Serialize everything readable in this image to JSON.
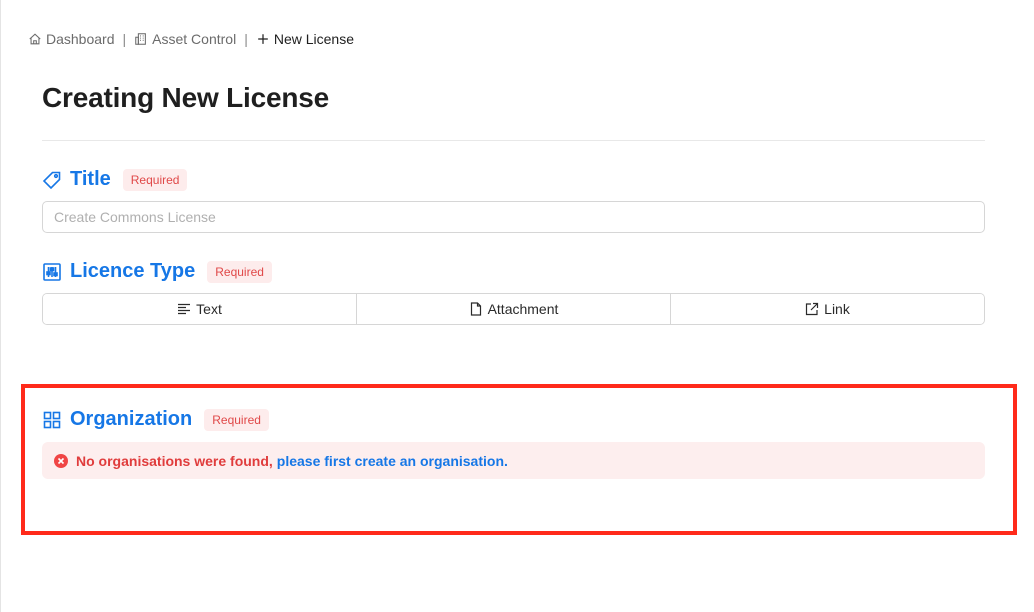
{
  "breadcrumb": {
    "items": [
      {
        "label": "Dashboard",
        "icon": "home-icon"
      },
      {
        "label": "Asset Control",
        "icon": "building-icon"
      },
      {
        "label": "New License",
        "icon": "plus-icon"
      }
    ],
    "separator": "|"
  },
  "page": {
    "title": "Creating New License"
  },
  "sections": {
    "title": {
      "label": "Title",
      "badge": "Required",
      "icon": "tag-icon",
      "placeholder": "Create Commons License",
      "value": ""
    },
    "licence_type": {
      "label": "Licence Type",
      "badge": "Required",
      "icon": "sliders-icon",
      "options": [
        {
          "label": "Text",
          "icon": "text-lines-icon"
        },
        {
          "label": "Attachment",
          "icon": "file-icon"
        },
        {
          "label": "Link",
          "icon": "external-link-icon"
        }
      ]
    },
    "organization": {
      "label": "Organization",
      "badge": "Required",
      "icon": "grid-icon",
      "alert": {
        "text": "No organisations were found,",
        "link": "please first create an organisation."
      }
    }
  },
  "colors": {
    "accent": "#1677e6",
    "required": "#e04848",
    "alert_bg": "#fdeeee",
    "highlight": "#ff2a1a"
  }
}
